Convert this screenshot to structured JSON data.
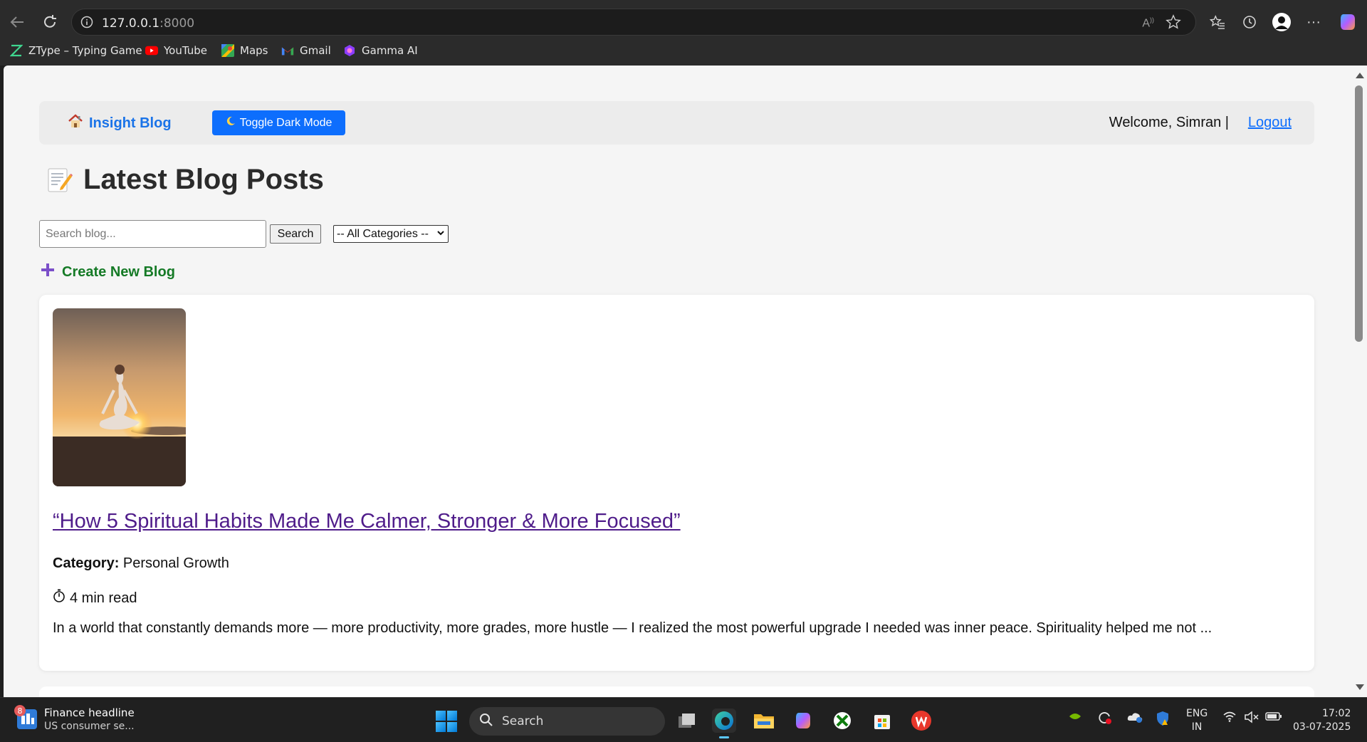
{
  "browser": {
    "url_host": "127.0.0.1",
    "url_port": ":8000",
    "bookmarks": [
      {
        "label": "ZType – Typing Game",
        "icon": "ztype-icon"
      },
      {
        "label": "YouTube",
        "icon": "youtube-icon"
      },
      {
        "label": "Maps",
        "icon": "maps-icon"
      },
      {
        "label": "Gmail",
        "icon": "gmail-icon"
      },
      {
        "label": "Gamma AI",
        "icon": "gamma-icon"
      }
    ]
  },
  "navbar": {
    "brand": "Insight Blog",
    "toggle_label": "Toggle Dark Mode",
    "welcome": "Welcome, Simran |",
    "logout": "Logout"
  },
  "page": {
    "title": "Latest Blog Posts",
    "search_placeholder": "Search blog...",
    "search_button": "Search",
    "category_selected": "-- All Categories --",
    "create_link": "Create New Blog"
  },
  "posts": [
    {
      "title": "“How 5 Spiritual Habits Made Me Calmer, Stronger & More Focused”",
      "category_label": "Category:",
      "category": "Personal Growth",
      "read_time": "4 min read",
      "excerpt": "In a world that constantly demands more — more productivity, more grades, more hustle — I realized the most powerful upgrade I needed was inner peace. Spirituality helped me not ..."
    }
  ],
  "taskbar": {
    "widget_badge": "8",
    "widget_title": "Finance headline",
    "widget_sub": "US consumer se...",
    "search_label": "Search",
    "lang_1": "ENG",
    "lang_2": "IN",
    "time": "17:02",
    "date": "03-07-2025"
  },
  "colors": {
    "accent": "#0d6efd",
    "create_green": "#157a26",
    "post_link": "#4f1c8a"
  }
}
